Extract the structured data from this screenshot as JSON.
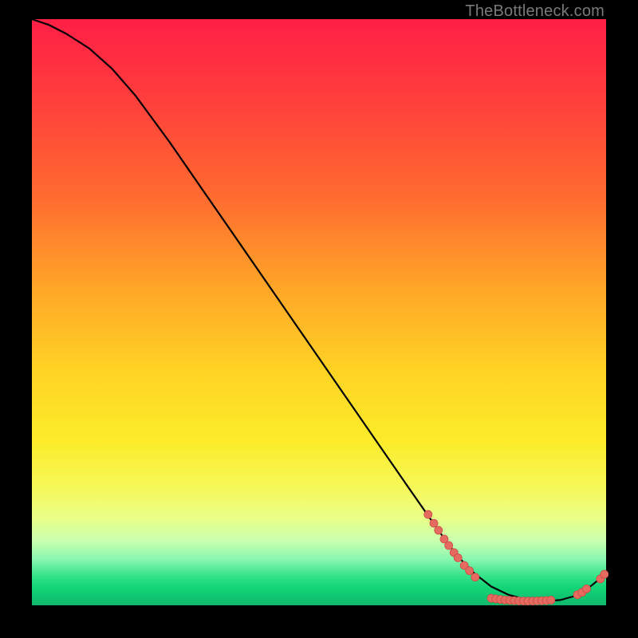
{
  "watermark": "TheBottleneck.com",
  "colors": {
    "bg": "#000000",
    "curve": "#000000",
    "dot": "#e56a5f",
    "dotOutline": "#c94d47"
  },
  "chart_data": {
    "type": "line",
    "title": "",
    "xlabel": "",
    "ylabel": "",
    "xlim": [
      0,
      100
    ],
    "ylim": [
      0,
      100
    ],
    "grid": false,
    "series": [
      {
        "name": "curve",
        "x": [
          0,
          3,
          6,
          10,
          14,
          18,
          24,
          30,
          36,
          42,
          48,
          54,
          60,
          66,
          71,
          74,
          77,
          80,
          83,
          86,
          89,
          92,
          95,
          97,
          99,
          100
        ],
        "y": [
          100,
          99,
          97.5,
          95,
          91.5,
          87,
          79,
          70.5,
          62,
          53.5,
          45,
          36.5,
          28,
          19.5,
          12.5,
          8.5,
          5.5,
          3.2,
          1.8,
          1.0,
          0.7,
          0.9,
          1.7,
          3.0,
          4.6,
          5.5
        ]
      }
    ],
    "points": [
      {
        "name": "cluster-left",
        "x": 69.0,
        "y": 15.5
      },
      {
        "name": "cluster-left",
        "x": 70.0,
        "y": 14.0
      },
      {
        "name": "cluster-left",
        "x": 70.8,
        "y": 12.8
      },
      {
        "name": "cluster-left",
        "x": 71.8,
        "y": 11.3
      },
      {
        "name": "cluster-left",
        "x": 72.6,
        "y": 10.2
      },
      {
        "name": "cluster-left",
        "x": 73.5,
        "y": 9.0
      },
      {
        "name": "cluster-left",
        "x": 74.2,
        "y": 8.1
      },
      {
        "name": "cluster-left",
        "x": 75.3,
        "y": 6.8
      },
      {
        "name": "cluster-left",
        "x": 76.2,
        "y": 5.9
      },
      {
        "name": "cluster-left",
        "x": 77.2,
        "y": 4.8
      },
      {
        "name": "flat-run",
        "x": 80.0,
        "y": 1.2
      },
      {
        "name": "flat-run",
        "x": 80.8,
        "y": 1.1
      },
      {
        "name": "flat-run",
        "x": 81.6,
        "y": 1.0
      },
      {
        "name": "flat-run",
        "x": 82.4,
        "y": 0.9
      },
      {
        "name": "flat-run",
        "x": 83.2,
        "y": 0.85
      },
      {
        "name": "flat-run",
        "x": 84.0,
        "y": 0.8
      },
      {
        "name": "flat-run",
        "x": 84.8,
        "y": 0.75
      },
      {
        "name": "flat-run",
        "x": 85.6,
        "y": 0.73
      },
      {
        "name": "flat-run",
        "x": 86.4,
        "y": 0.72
      },
      {
        "name": "flat-run",
        "x": 87.2,
        "y": 0.72
      },
      {
        "name": "flat-run",
        "x": 88.0,
        "y": 0.75
      },
      {
        "name": "flat-run",
        "x": 88.8,
        "y": 0.78
      },
      {
        "name": "flat-run",
        "x": 89.6,
        "y": 0.82
      },
      {
        "name": "flat-run",
        "x": 90.4,
        "y": 0.88
      },
      {
        "name": "right-rise",
        "x": 95.0,
        "y": 1.8
      },
      {
        "name": "right-rise",
        "x": 95.8,
        "y": 2.2
      },
      {
        "name": "right-rise",
        "x": 96.6,
        "y": 2.8
      },
      {
        "name": "tail",
        "x": 99.0,
        "y": 4.5
      },
      {
        "name": "tail",
        "x": 99.7,
        "y": 5.3
      }
    ]
  }
}
